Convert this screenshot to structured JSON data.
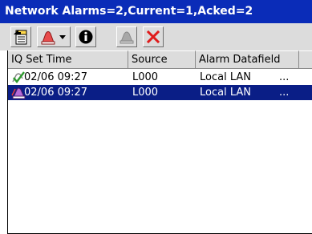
{
  "window": {
    "title": "Network Alarms=2,Current=1,Acked=2"
  },
  "toolbar": {
    "buttons": [
      {
        "name": "export-button",
        "icon": "export-icon"
      },
      {
        "name": "alarm-filter-dropdown",
        "icon": "alarm-bell-dropdown-icon"
      },
      {
        "name": "info-button",
        "icon": "info-icon"
      },
      {
        "name": "acknowledge-button",
        "icon": "acknowledge-bell-icon",
        "state": "disabled"
      },
      {
        "name": "delete-button",
        "icon": "red-x-icon"
      }
    ]
  },
  "table": {
    "columns": [
      "IQ Set Time",
      "Source",
      "Alarm Datafield"
    ],
    "rows": [
      {
        "icon": "acknowledged-check-icon",
        "time": "02/06 09:27",
        "source": "L000",
        "datafield": "Local LAN",
        "more": "...",
        "selected": false
      },
      {
        "icon": "active-alarm-icon",
        "time": "02/06 09:27",
        "source": "L000",
        "datafield": "Local LAN",
        "more": "...",
        "selected": true
      }
    ]
  },
  "colors": {
    "title_bar": "#0a2cb8",
    "selection": "#0a1e86",
    "chrome": "#dcdcdc"
  }
}
